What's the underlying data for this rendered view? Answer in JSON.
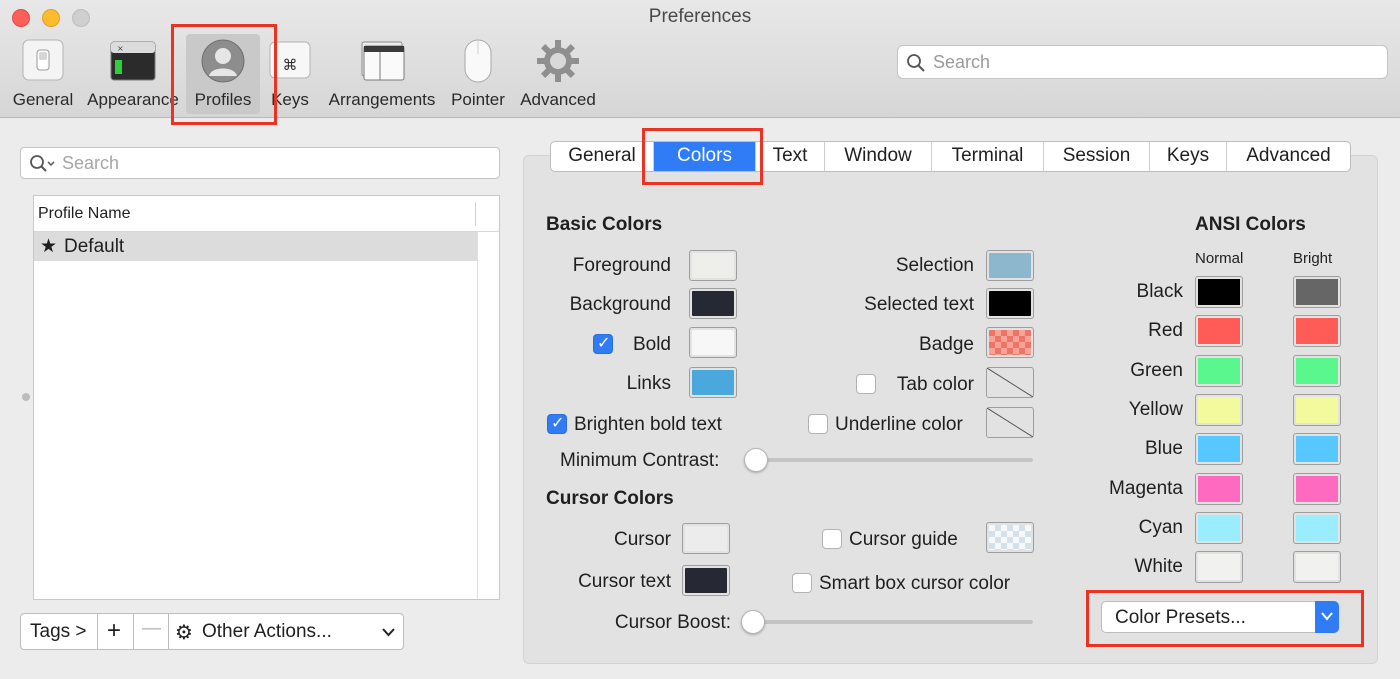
{
  "window": {
    "title": "Preferences"
  },
  "toolbar": {
    "items": [
      {
        "label": "General",
        "icon": "switch-icon"
      },
      {
        "label": "Appearance",
        "icon": "terminal-window-icon"
      },
      {
        "label": "Profiles",
        "icon": "user-silhouette-icon",
        "selected": true
      },
      {
        "label": "Keys",
        "icon": "command-key-icon"
      },
      {
        "label": "Arrangements",
        "icon": "window-stack-icon"
      },
      {
        "label": "Pointer",
        "icon": "mouse-icon"
      },
      {
        "label": "Advanced",
        "icon": "gear-icon"
      }
    ],
    "search_placeholder": "Search"
  },
  "profiles": {
    "search_placeholder": "Search",
    "column_header": "Profile Name",
    "rows": [
      {
        "name": "Default",
        "default": true
      }
    ],
    "buttons": {
      "tags": "Tags >",
      "add": "+",
      "remove": "—",
      "other_actions": "Other Actions..."
    }
  },
  "tabs": [
    {
      "label": "General"
    },
    {
      "label": "Colors",
      "active": true
    },
    {
      "label": "Text"
    },
    {
      "label": "Window"
    },
    {
      "label": "Terminal"
    },
    {
      "label": "Session"
    },
    {
      "label": "Keys"
    },
    {
      "label": "Advanced"
    }
  ],
  "basic_colors": {
    "title": "Basic Colors",
    "left": [
      {
        "label": "Foreground",
        "color": "#eeeeeb"
      },
      {
        "label": "Background",
        "color": "#262834"
      },
      {
        "label": "Bold",
        "color": "#f7f7f7",
        "checkbox": true,
        "checked": true
      },
      {
        "label": "Links",
        "color": "#4aa8dc"
      }
    ],
    "right": [
      {
        "label": "Selection",
        "color": "#8db7cd"
      },
      {
        "label": "Selected text",
        "color": "#000000"
      },
      {
        "label": "Badge",
        "color": "#ee7466",
        "pattern": "checker"
      },
      {
        "label": "Tab color",
        "color": "none",
        "checkbox": true,
        "checked": false
      },
      {
        "label": "Underline color",
        "color": "none",
        "checkbox": true,
        "checked": false
      }
    ],
    "brighten_bold": {
      "label": "Brighten bold text",
      "checked": true
    },
    "min_contrast": {
      "label": "Minimum Contrast:",
      "value": 0
    }
  },
  "cursor_colors": {
    "title": "Cursor Colors",
    "cursor": {
      "label": "Cursor",
      "color": "#ececec"
    },
    "cursor_text": {
      "label": "Cursor text",
      "color": "#262834"
    },
    "cursor_guide": {
      "label": "Cursor guide",
      "checked": false,
      "color": "#d3e1ea"
    },
    "smart_box": {
      "label": "Smart box cursor color",
      "checked": false
    },
    "cursor_boost": {
      "label": "Cursor Boost:",
      "value": 0
    }
  },
  "ansi_colors": {
    "title": "ANSI Colors",
    "normal_header": "Normal",
    "bright_header": "Bright",
    "rows": [
      {
        "label": "Black",
        "normal": "#000000",
        "bright": "#666666"
      },
      {
        "label": "Red",
        "normal": "#ff5c57",
        "bright": "#ff5c57"
      },
      {
        "label": "Green",
        "normal": "#5af78e",
        "bright": "#5af78e"
      },
      {
        "label": "Yellow",
        "normal": "#f3f99d",
        "bright": "#f3f99d"
      },
      {
        "label": "Blue",
        "normal": "#57c7ff",
        "bright": "#57c7ff"
      },
      {
        "label": "Magenta",
        "normal": "#ff6ac1",
        "bright": "#ff6ac1"
      },
      {
        "label": "Cyan",
        "normal": "#9aedfe",
        "bright": "#9aedfe"
      },
      {
        "label": "White",
        "normal": "#f1f1f0",
        "bright": "#f1f1f0"
      }
    ]
  },
  "color_presets": {
    "label": "Color Presets..."
  },
  "colors": {
    "accent": "#2f7cf6",
    "highlight": "#ea3323"
  }
}
